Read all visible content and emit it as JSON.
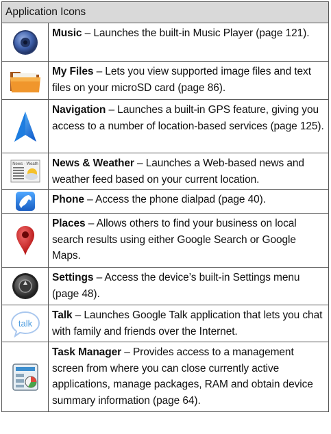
{
  "table": {
    "header": "Application Icons",
    "rows": [
      {
        "icon": "music-icon",
        "name": "Music",
        "description": " – Launches the built-in Music Player (page 121)."
      },
      {
        "icon": "folder-icon",
        "name": "My Files",
        "description": " – Lets you view supported image files and text files on your microSD card (page 86)."
      },
      {
        "icon": "navigation-arrow-icon",
        "name": "Navigation",
        "description": " – Launches a built-in GPS feature, giving you access to a number of location-based services (page 125)."
      },
      {
        "icon": "newspaper-icon",
        "name": "News & Weather",
        "description": " – Launches a Web-based news and weather feed based on your current location."
      },
      {
        "icon": "phone-handset-icon",
        "name": "Phone",
        "description": " – Access the phone dialpad (page 40)."
      },
      {
        "icon": "map-pin-icon",
        "name": "Places",
        "description": " – Allows others to find your business on local search results using either Google Search or Google Maps."
      },
      {
        "icon": "settings-dial-icon",
        "name": "Settings",
        "description": " – Access the device’s built-in Settings menu (page 48)."
      },
      {
        "icon": "talk-bubble-icon",
        "name": "Talk",
        "description": " – Launches Google Talk application that lets you chat with family and friends over the Internet."
      },
      {
        "icon": "task-manager-icon",
        "name": "Task Manager",
        "description": " – Provides access to a management screen from where you can close currently active applications, manage packages, RAM and obtain device summary information (page 64)."
      }
    ]
  },
  "icon_text": {
    "talk": "talk",
    "news_header": "News · Weath"
  },
  "colors": {
    "header_bg": "#d9d9d9",
    "border": "#555555"
  }
}
